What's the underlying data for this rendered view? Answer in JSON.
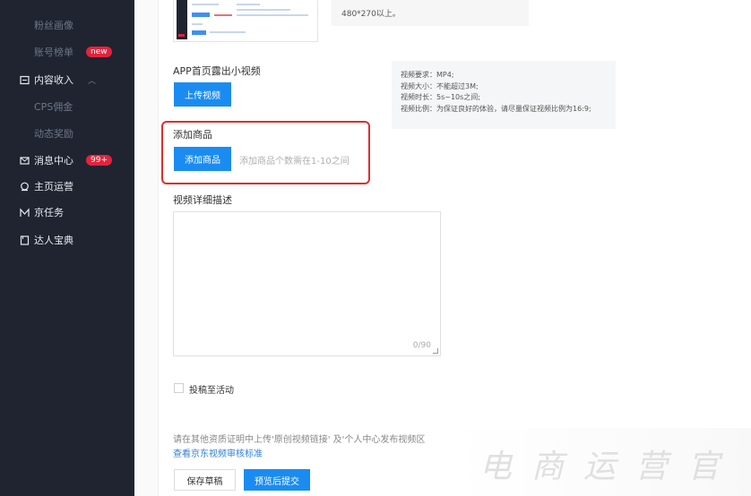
{
  "sidebar": {
    "items": [
      {
        "label": "粉丝画像"
      },
      {
        "label": "账号榜单",
        "badge": "new"
      },
      {
        "label": "内容收入",
        "icon": "income-icon",
        "chevron": "︿"
      },
      {
        "label": "CPS佣金"
      },
      {
        "label": "动态奖励"
      },
      {
        "label": "消息中心",
        "icon": "message-icon",
        "badge": "99+"
      },
      {
        "label": "主页运营",
        "icon": "homepage-icon"
      },
      {
        "label": "京任务",
        "icon": "task-icon"
      },
      {
        "label": "达人宝典",
        "icon": "guide-icon"
      }
    ]
  },
  "cover_hint": "480*270以上。",
  "app_video": {
    "label": "APP首页露出小视频",
    "upload_button": "上传视频",
    "requirements": [
      "视频要求：MP4;",
      "视频大小：不能超过3M;",
      "视频时长：5s~10s之间;",
      "视频比例：为保证良好的体验，请尽量保证视频比例为16:9;"
    ]
  },
  "product": {
    "label": "添加商品",
    "button": "添加商品",
    "hint": "添加商品个数需在1-10之间"
  },
  "description": {
    "label": "视频详细描述",
    "counter": "0/90"
  },
  "activity": {
    "label": "投稿至活动"
  },
  "footer": {
    "note": "请在其他资质证明中上传'原创视频链接' 及'个人中心发布视频区",
    "link": "查看京东视频审核标准",
    "save_draft": "保存草稿",
    "preview_submit": "预览后提交"
  },
  "watermark": "电商运营官"
}
